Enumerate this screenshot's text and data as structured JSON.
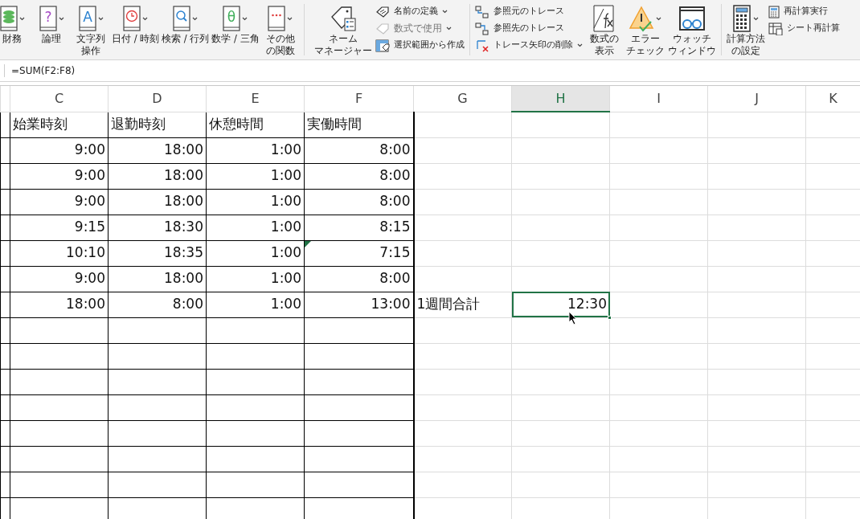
{
  "ribbon": {
    "groups": [
      {
        "kind": "functions",
        "items": [
          {
            "label": "財務",
            "dropdown": true
          },
          {
            "label": "論理",
            "glyph": "?",
            "dropdown": true
          },
          {
            "label": "文字列操作",
            "glyph": "A",
            "dropdown": true
          },
          {
            "label": "日付 / 時刻",
            "dropdown": true
          },
          {
            "label": "検索 / 行列",
            "dropdown": true
          },
          {
            "label": "数学 / 三角",
            "glyph": "θ",
            "dropdown": true
          },
          {
            "label": "その他の関数",
            "dropdown": true
          }
        ]
      },
      {
        "kind": "names",
        "large": [
          {
            "label": "ネームマネージャー",
            "dropdown": false
          }
        ],
        "small": [
          {
            "label": "名前の定義",
            "dropdown": true,
            "disabled": false
          },
          {
            "label": "数式で使用",
            "dropdown": true,
            "disabled": true
          },
          {
            "label": "選択範囲から作成",
            "dropdown": false,
            "disabled": false
          }
        ]
      },
      {
        "kind": "auditing",
        "small": [
          {
            "label": "参照元のトレース",
            "dropdown": false,
            "disabled": false
          },
          {
            "label": "参照先のトレース",
            "dropdown": false,
            "disabled": false
          },
          {
            "label": "トレース矢印の削除",
            "dropdown": true,
            "disabled": false
          }
        ],
        "large": [
          {
            "label": "数式の表示",
            "dropdown": false
          },
          {
            "label": "エラーチェック",
            "dropdown": true
          },
          {
            "label": "ウォッチウィンドウ",
            "dropdown": false
          }
        ]
      },
      {
        "kind": "calculation",
        "large": [
          {
            "label": "計算方法の設定",
            "dropdown": true
          }
        ],
        "small": [
          {
            "label": "再計算実行",
            "dropdown": false,
            "disabled": false
          },
          {
            "label": "シート再計算",
            "dropdown": false,
            "disabled": false
          }
        ]
      }
    ]
  },
  "formula_bar": {
    "formula": "=SUM(F2:F8)"
  },
  "sheet": {
    "columns": [
      {
        "label": "C",
        "selected": false
      },
      {
        "label": "D",
        "selected": false
      },
      {
        "label": "E",
        "selected": false
      },
      {
        "label": "F",
        "selected": false
      },
      {
        "label": "G",
        "selected": false
      },
      {
        "label": "H",
        "selected": true
      },
      {
        "label": "I",
        "selected": false
      },
      {
        "label": "J",
        "selected": false
      },
      {
        "label": "K",
        "selected": false
      }
    ],
    "rows": [
      {
        "cells": [
          {
            "text": "始業時刻",
            "kind": "text",
            "selected": false,
            "error_indicator": false
          },
          {
            "text": "退勤時刻",
            "kind": "text",
            "selected": false,
            "error_indicator": false
          },
          {
            "text": "休憩時間",
            "kind": "text",
            "selected": false,
            "error_indicator": false
          },
          {
            "text": "実働時間",
            "kind": "text",
            "selected": false,
            "error_indicator": false
          }
        ]
      },
      {
        "cells": [
          {
            "text": "9:00",
            "kind": "number",
            "selected": false,
            "error_indicator": false
          },
          {
            "text": "18:00",
            "kind": "number",
            "selected": false,
            "error_indicator": false
          },
          {
            "text": "1:00",
            "kind": "number",
            "selected": false,
            "error_indicator": false
          },
          {
            "text": "8:00",
            "kind": "number",
            "selected": false,
            "error_indicator": false
          }
        ]
      },
      {
        "cells": [
          {
            "text": "9:00",
            "kind": "number",
            "selected": false,
            "error_indicator": false
          },
          {
            "text": "18:00",
            "kind": "number",
            "selected": false,
            "error_indicator": false
          },
          {
            "text": "1:00",
            "kind": "number",
            "selected": false,
            "error_indicator": false
          },
          {
            "text": "8:00",
            "kind": "number",
            "selected": false,
            "error_indicator": false
          }
        ]
      },
      {
        "cells": [
          {
            "text": "9:00",
            "kind": "number",
            "selected": false,
            "error_indicator": false
          },
          {
            "text": "18:00",
            "kind": "number",
            "selected": false,
            "error_indicator": false
          },
          {
            "text": "1:00",
            "kind": "number",
            "selected": false,
            "error_indicator": false
          },
          {
            "text": "8:00",
            "kind": "number",
            "selected": false,
            "error_indicator": false
          }
        ]
      },
      {
        "cells": [
          {
            "text": "9:15",
            "kind": "number",
            "selected": false,
            "error_indicator": false
          },
          {
            "text": "18:30",
            "kind": "number",
            "selected": false,
            "error_indicator": false
          },
          {
            "text": "1:00",
            "kind": "number",
            "selected": false,
            "error_indicator": false
          },
          {
            "text": "8:15",
            "kind": "number",
            "selected": false,
            "error_indicator": false
          }
        ]
      },
      {
        "cells": [
          {
            "text": "10:10",
            "kind": "number",
            "selected": false,
            "error_indicator": false
          },
          {
            "text": "18:35",
            "kind": "number",
            "selected": false,
            "error_indicator": false
          },
          {
            "text": "1:00",
            "kind": "number",
            "selected": false,
            "error_indicator": false
          },
          {
            "text": "7:15",
            "kind": "number",
            "selected": false,
            "error_indicator": true
          }
        ]
      },
      {
        "cells": [
          {
            "text": "9:00",
            "kind": "number",
            "selected": false,
            "error_indicator": false
          },
          {
            "text": "18:00",
            "kind": "number",
            "selected": false,
            "error_indicator": false
          },
          {
            "text": "1:00",
            "kind": "number",
            "selected": false,
            "error_indicator": false
          },
          {
            "text": "8:00",
            "kind": "number",
            "selected": false,
            "error_indicator": false
          }
        ]
      },
      {
        "cells": [
          {
            "text": "18:00",
            "kind": "number",
            "selected": false,
            "error_indicator": false
          },
          {
            "text": "8:00",
            "kind": "number",
            "selected": false,
            "error_indicator": false
          },
          {
            "text": "1:00",
            "kind": "number",
            "selected": false,
            "error_indicator": false
          },
          {
            "text": "13:00",
            "kind": "number",
            "selected": false,
            "error_indicator": false
          },
          {
            "text": "1週間合計",
            "kind": "text",
            "selected": false,
            "error_indicator": false
          },
          {
            "text": "12:30",
            "kind": "number",
            "selected": true,
            "error_indicator": false
          }
        ]
      }
    ]
  }
}
